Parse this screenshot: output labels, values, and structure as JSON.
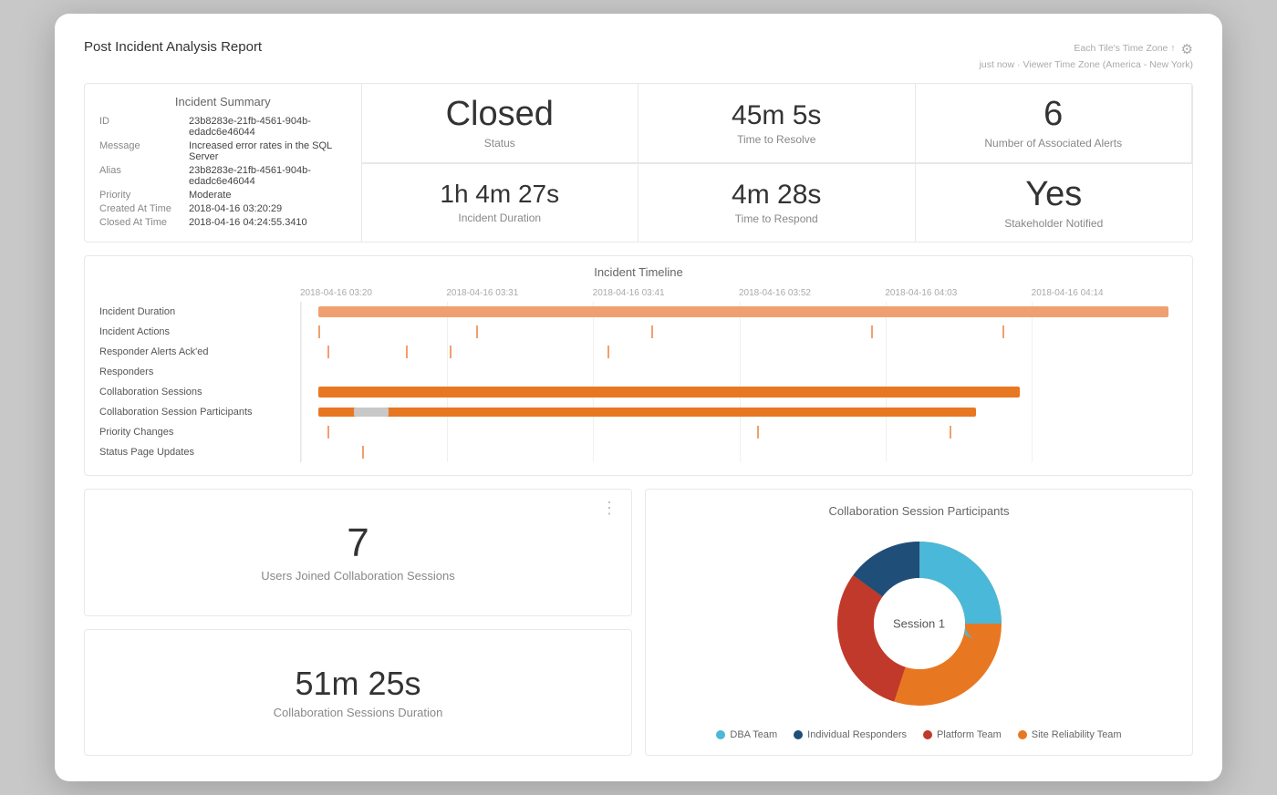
{
  "header": {
    "title": "Post Incident Analysis Report",
    "timezone_label": "Each Tile's Time Zone ↑",
    "viewer_tz": "Viewer Time Zone (America - New York)",
    "timestamp": "just now"
  },
  "incident_summary": {
    "section_title": "Incident Summary",
    "rows": [
      {
        "key": "ID",
        "value": "23b8283e-21fb-4561-904b-edadc6e46044"
      },
      {
        "key": "Message",
        "value": "Increased error rates in the SQL Server"
      },
      {
        "key": "Alias",
        "value": "23b8283e-21fb-4561-904b-edadc6e46044"
      },
      {
        "key": "Priority",
        "value": "Moderate"
      },
      {
        "key": "Created At Time",
        "value": "2018-04-16 03:20:29"
      },
      {
        "key": "Closed At Time",
        "value": "2018-04-16 04:24:55.3410"
      }
    ]
  },
  "metrics": {
    "status": {
      "value": "Closed",
      "label": "Status"
    },
    "time_to_resolve": {
      "value": "45m 5s",
      "label": "Time to Resolve"
    },
    "associated_alerts": {
      "value": "6",
      "label": "Number of Associated Alerts"
    },
    "incident_duration": {
      "value": "1h 4m 27s",
      "label": "Incident Duration"
    },
    "time_to_respond": {
      "value": "4m 28s",
      "label": "Time to Respond"
    },
    "stakeholder": {
      "value": "Yes",
      "label": "Stakeholder Notified"
    }
  },
  "timeline": {
    "title": "Incident Timeline",
    "columns": [
      "2018-04-16 03:20",
      "2018-04-16 03:31",
      "2018-04-16 03:41",
      "2018-04-16 03:52",
      "2018-04-16 04:03",
      "2018-04-16 04:14"
    ],
    "rows": [
      {
        "label": "Incident Duration"
      },
      {
        "label": "Incident Actions"
      },
      {
        "label": "Responder Alerts Ack'ed"
      },
      {
        "label": "Responders"
      },
      {
        "label": "Collaboration Sessions"
      },
      {
        "label": "Collaboration Session Participants"
      },
      {
        "label": "Priority Changes"
      },
      {
        "label": "Status Page Updates"
      }
    ]
  },
  "bottom": {
    "users_joined": {
      "value": "7",
      "label": "Users Joined Collaboration Sessions"
    },
    "sessions_duration": {
      "value": "51m 25s",
      "label": "Collaboration Sessions Duration"
    },
    "collab_title": "Collaboration Session Participants",
    "donut_label": "Session 1",
    "legend": [
      {
        "label": "DBA Team",
        "color": "#4ab8d8"
      },
      {
        "label": "Individual Responders",
        "color": "#1f4e79"
      },
      {
        "label": "Platform Team",
        "color": "#c0392b"
      },
      {
        "label": "Site Reliability Team",
        "color": "#e87722"
      }
    ]
  }
}
